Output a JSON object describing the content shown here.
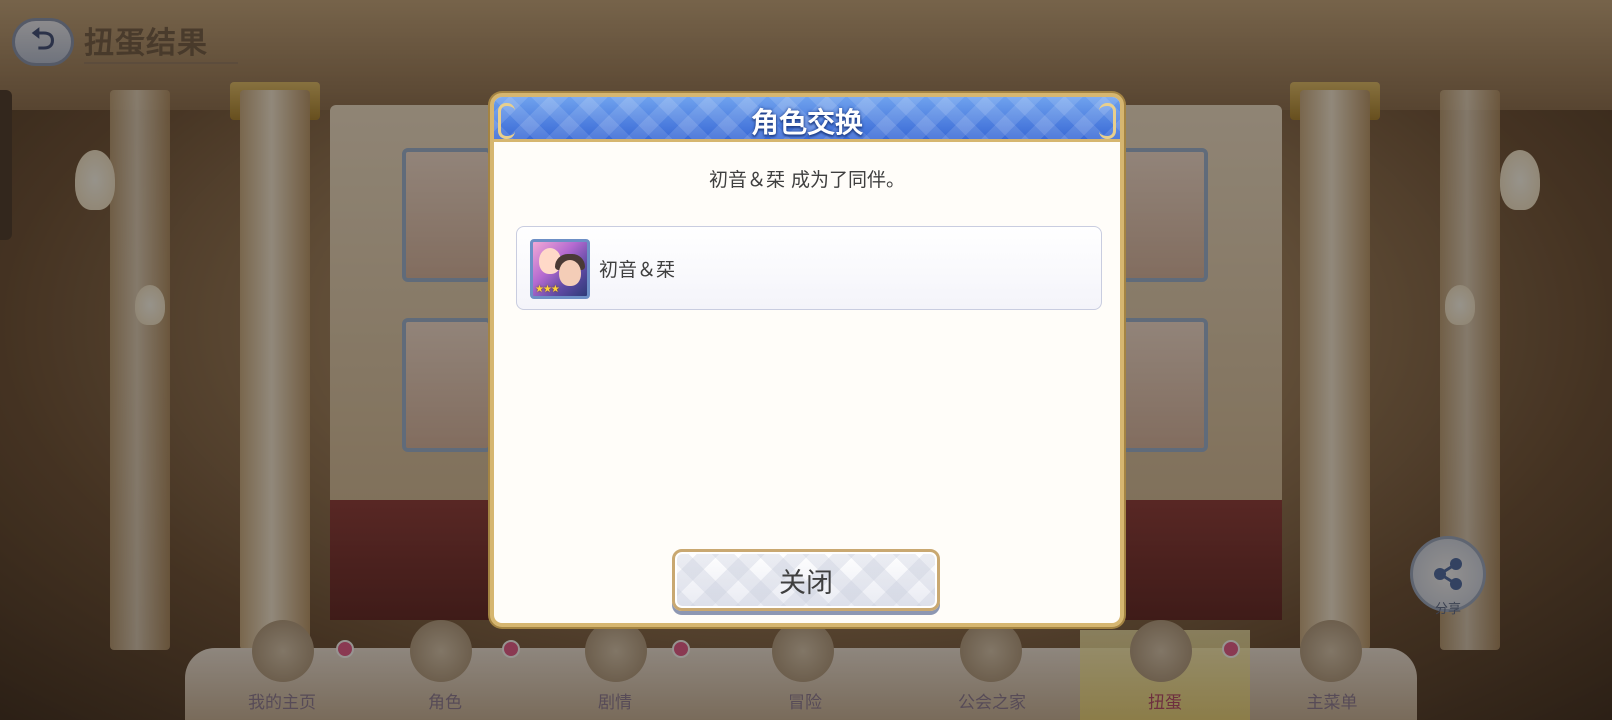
{
  "header": {
    "title": "扭蛋结果",
    "back_symbol": "⮌"
  },
  "share": {
    "label": "分享"
  },
  "bottom_nav": {
    "items": [
      {
        "label": "我的主页",
        "icon": "home-icon",
        "badge": true
      },
      {
        "label": "角色",
        "icon": "character-icon",
        "badge": true
      },
      {
        "label": "剧情",
        "icon": "story-scroll-icon",
        "badge": true
      },
      {
        "label": "冒险",
        "icon": "adventure-sword-icon",
        "badge": false
      },
      {
        "label": "公会之家",
        "icon": "guild-house-icon",
        "badge": false
      },
      {
        "label": "扭蛋",
        "icon": "gacha-icon",
        "badge": true,
        "active": true
      },
      {
        "label": "主菜单",
        "icon": "main-menu-crystal-icon",
        "badge": false
      }
    ]
  },
  "dialog": {
    "title": "角色交换",
    "message": "初音＆栞  成为了同伴。",
    "result": {
      "name": "初音＆栞",
      "stars": "★★★"
    },
    "close_label": "关闭"
  },
  "colors": {
    "header_blue": "#3a6ad6",
    "frame_gold": "#d6b670",
    "text_dark": "#3f3f3f",
    "badge_pink": "#e85a8c"
  }
}
